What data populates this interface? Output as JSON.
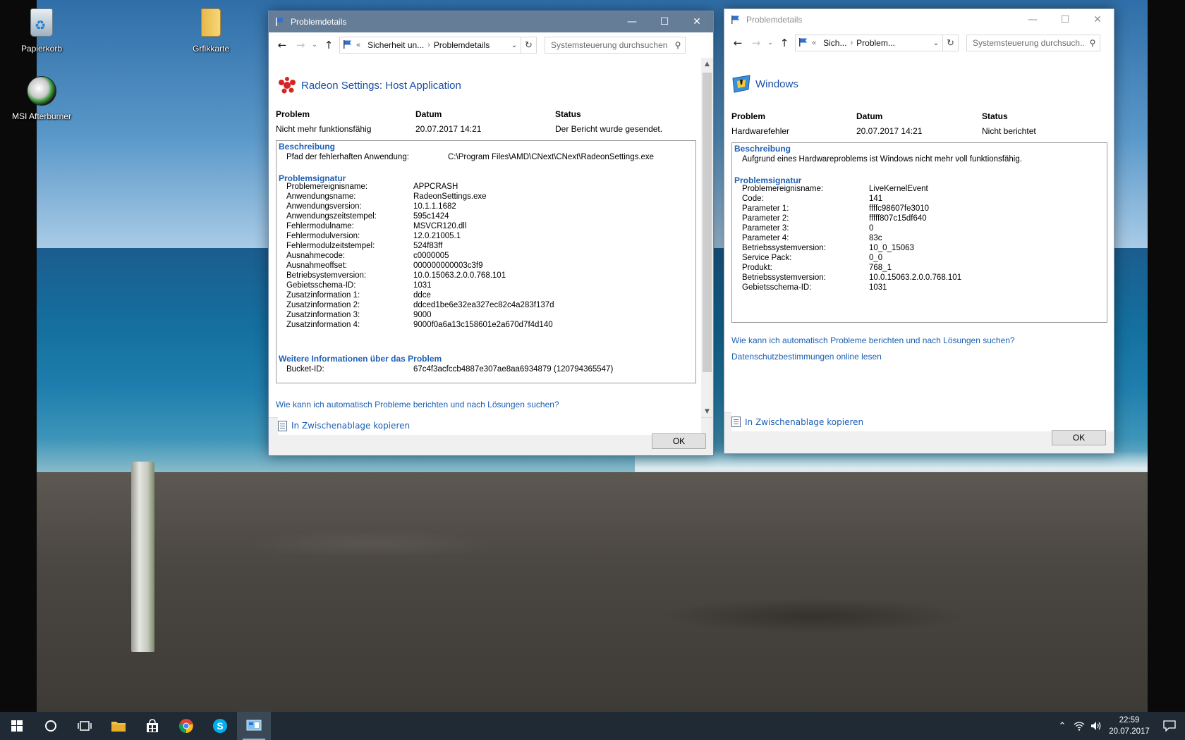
{
  "desktop": {
    "icons": [
      {
        "label": "Papierkorb",
        "icon": "recycle-bin-icon"
      },
      {
        "label": "Grfikkarte",
        "icon": "folder-icon"
      },
      {
        "label": "MSI Afterburner",
        "icon": "msi-afterburner-icon"
      }
    ]
  },
  "window1": {
    "title": "Problemdetails",
    "breadcrumb": {
      "prefix": "«",
      "parent": "Sicherheit un...",
      "current": "Problemdetails"
    },
    "search_placeholder": "Systemsteuerung durchsuchen",
    "app_title": "Radeon Settings: Host Application",
    "headers": {
      "problem": "Problem",
      "date": "Datum",
      "status": "Status"
    },
    "values": {
      "problem": "Nicht mehr funktionsfähig",
      "date": "20.07.2017 14:21",
      "status": "Der Bericht wurde gesendet."
    },
    "description": {
      "heading": "Beschreibung",
      "path_label": "Pfad der fehlerhaften Anwendung:",
      "path_value": "C:\\Program Files\\AMD\\CNext\\CNext\\RadeonSettings.exe"
    },
    "signature": {
      "heading": "Problemsignatur",
      "rows": [
        {
          "k": "Problemereignisname:",
          "v": "APPCRASH"
        },
        {
          "k": "Anwendungsname:",
          "v": "RadeonSettings.exe"
        },
        {
          "k": "Anwendungsversion:",
          "v": "10.1.1.1682"
        },
        {
          "k": "Anwendungszeitstempel:",
          "v": "595c1424"
        },
        {
          "k": "Fehlermodulname:",
          "v": "MSVCR120.dll"
        },
        {
          "k": "Fehlermodulversion:",
          "v": "12.0.21005.1"
        },
        {
          "k": "Fehlermodulzeitstempel:",
          "v": "524f83ff"
        },
        {
          "k": "Ausnahmecode:",
          "v": "c0000005"
        },
        {
          "k": "Ausnahmeoffset:",
          "v": "000000000003c3f9"
        },
        {
          "k": "Betriebsystemversion:",
          "v": "10.0.15063.2.0.0.768.101"
        },
        {
          "k": "Gebietsschema-ID:",
          "v": "1031"
        },
        {
          "k": "Zusatzinformation 1:",
          "v": "ddce"
        },
        {
          "k": "Zusatzinformation 2:",
          "v": "ddced1be6e32ea327ec82c4a283f137d"
        },
        {
          "k": "Zusatzinformation 3:",
          "v": "9000"
        },
        {
          "k": "Zusatzinformation 4:",
          "v": "9000f0a6a13c158601e2a670d7f4d140"
        }
      ]
    },
    "more_info": {
      "heading": "Weitere Informationen über das Problem",
      "bucket_label": "Bucket-ID:",
      "bucket_value": "67c4f3acfccb4887e307ae8aa6934879 (120794365547)"
    },
    "link_solutions": "Wie kann ich automatisch Probleme berichten und nach Lösungen suchen?",
    "copy_label": "In Zwischenablage kopieren",
    "ok_label": "OK"
  },
  "window2": {
    "title": "Problemdetails",
    "breadcrumb": {
      "prefix": "«",
      "parent": "Sich...",
      "current": "Problem..."
    },
    "search_placeholder": "Systemsteuerung durchsuch...",
    "app_title": "Windows",
    "headers": {
      "problem": "Problem",
      "date": "Datum",
      "status": "Status"
    },
    "values": {
      "problem": "Hardwarefehler",
      "date": "20.07.2017 14:21",
      "status": "Nicht berichtet"
    },
    "description": {
      "heading": "Beschreibung",
      "text": "Aufgrund eines Hardwareproblems ist Windows nicht mehr voll funktionsfähig."
    },
    "signature": {
      "heading": "Problemsignatur",
      "rows": [
        {
          "k": "Problemereignisname:",
          "v": "LiveKernelEvent"
        },
        {
          "k": "Code:",
          "v": "141"
        },
        {
          "k": "Parameter 1:",
          "v": "ffffc98607fe3010"
        },
        {
          "k": "Parameter 2:",
          "v": "fffff807c15df640"
        },
        {
          "k": "Parameter 3:",
          "v": "0"
        },
        {
          "k": "Parameter 4:",
          "v": "83c"
        },
        {
          "k": "Betriebssystemversion:",
          "v": "10_0_15063"
        },
        {
          "k": "Service Pack:",
          "v": "0_0"
        },
        {
          "k": "Produkt:",
          "v": "768_1"
        },
        {
          "k": "Betriebssystemversion:",
          "v": "10.0.15063.2.0.0.768.101"
        },
        {
          "k": "Gebietsschema-ID:",
          "v": "1031"
        }
      ]
    },
    "link_solutions": "Wie kann ich automatisch Probleme berichten und nach Lösungen suchen?",
    "link_privacy": "Datenschutzbestimmungen online lesen",
    "copy_label": "In Zwischenablage kopieren",
    "ok_label": "OK"
  },
  "taskbar": {
    "apps": [
      "start-icon",
      "cortana-icon",
      "task-view-icon",
      "file-explorer-icon",
      "store-icon",
      "chrome-icon",
      "skype-icon",
      "control-panel-icon"
    ],
    "time": "22:59",
    "date": "20.07.2017"
  }
}
